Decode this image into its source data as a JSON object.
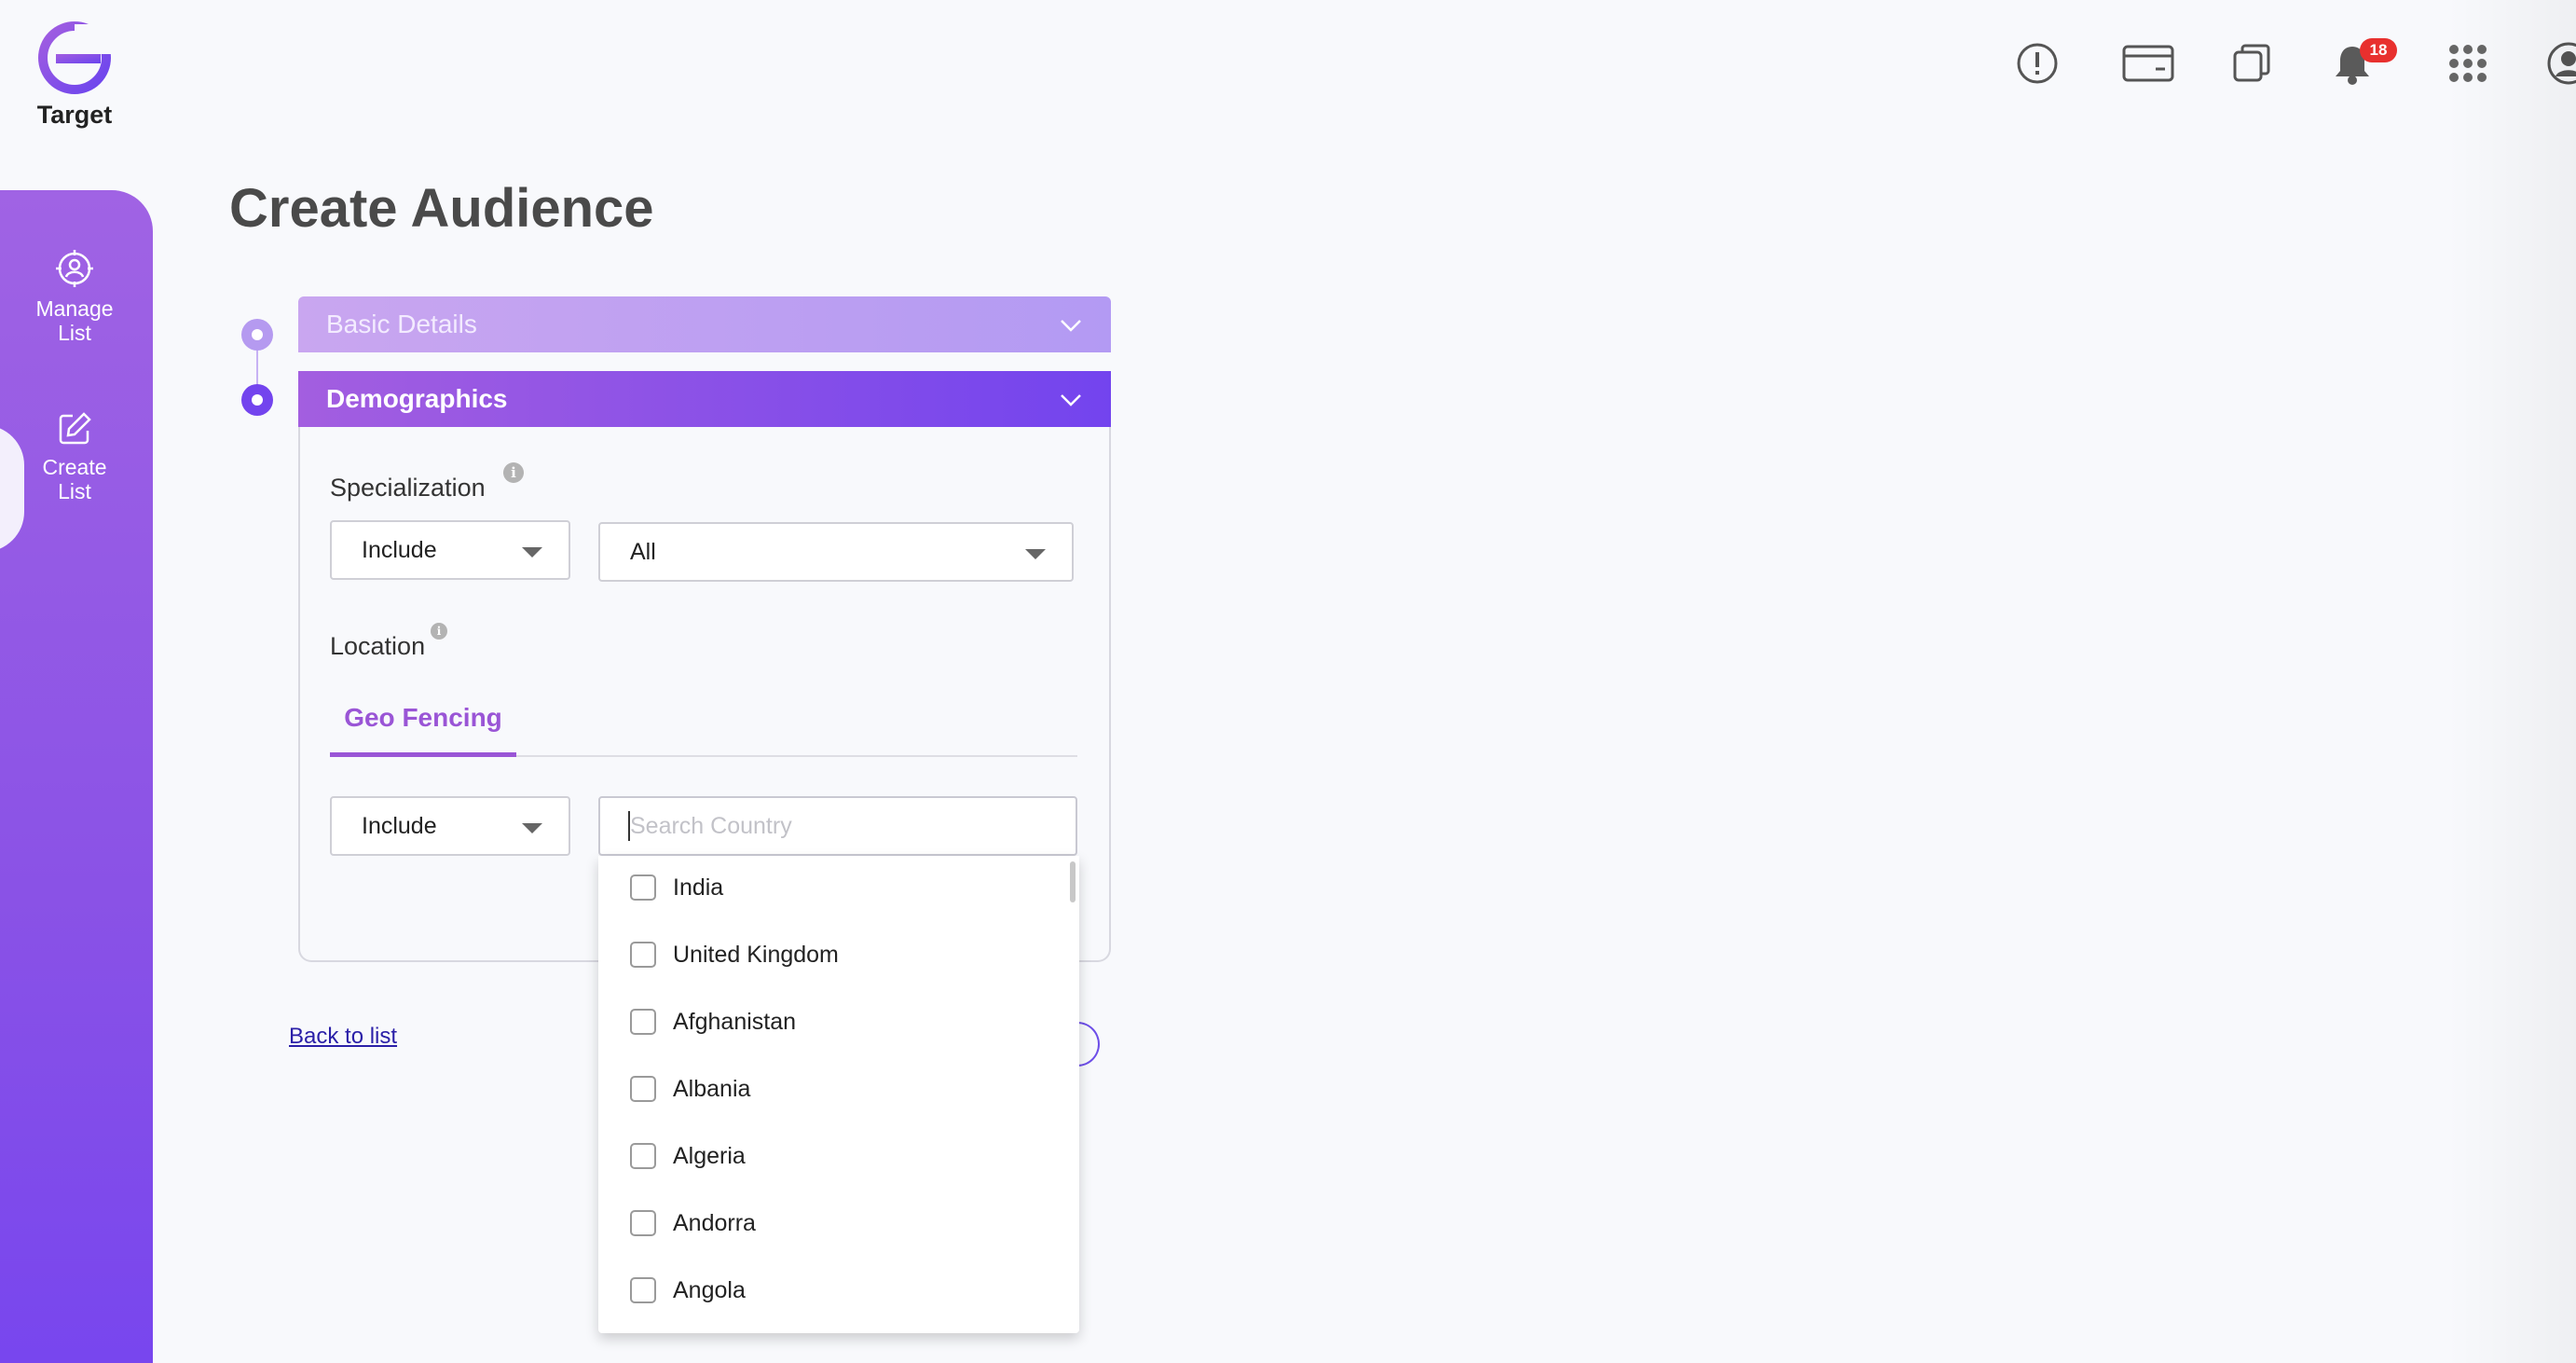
{
  "app": {
    "logo_text": "Target"
  },
  "header": {
    "notification_count": "18"
  },
  "sidebar": {
    "items": [
      {
        "label_line1": "Manage",
        "label_line2": "List"
      },
      {
        "label_line1": "Create",
        "label_line2": "List"
      }
    ]
  },
  "page": {
    "title": "Create Audience"
  },
  "steps": {
    "basic_details": "Basic Details",
    "demographics": "Demographics"
  },
  "demographics": {
    "specialization_label": "Specialization",
    "specialization_mode": "Include",
    "specialization_value": "All",
    "location_label": "Location",
    "geo_tab": "Geo Fencing",
    "location_mode": "Include",
    "search_placeholder": "Search Country",
    "search_value": ""
  },
  "countries": [
    "India",
    "United Kingdom",
    "Afghanistan",
    "Albania",
    "Algeria",
    "Andorra",
    "Angola"
  ],
  "footer": {
    "back_link": "Back to list"
  },
  "colors": {
    "accent": "#7344ee",
    "accent_light": "#a35ee0",
    "badge": "#e8302e"
  }
}
